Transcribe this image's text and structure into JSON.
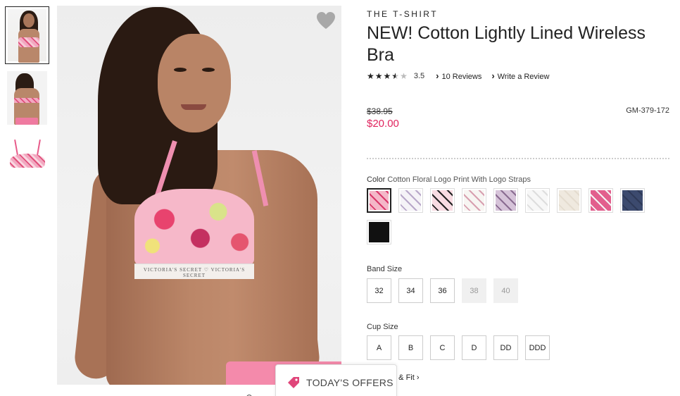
{
  "product": {
    "collection": "THE T-SHIRT",
    "title": "NEW! Cotton Lightly Lined Wireless Bra",
    "rating": 3.5,
    "rating_text": "3.5",
    "reviews_link": "10 Reviews",
    "write_review_link": "Write a Review",
    "old_price": "$38.95",
    "price": "$20.00",
    "sku": "GM-379-172"
  },
  "color": {
    "label": "Color",
    "selected": "Cotton Floral Logo Print With Logo Straps",
    "swatches": [
      {
        "name": "floral-logo-print",
        "bg": "#f4b7c8",
        "accent": "#d9376a"
      },
      {
        "name": "white-logo-print",
        "bg": "#f5f3f7",
        "accent": "#b8a7c9"
      },
      {
        "name": "pink-logo-black-band",
        "bg": "#f8dbe2",
        "accent": "#222222"
      },
      {
        "name": "white-script-print",
        "bg": "#f7f5f2",
        "accent": "#d8a0b0"
      },
      {
        "name": "purple-leopard",
        "bg": "#d6c3d9",
        "accent": "#8a6c91"
      },
      {
        "name": "white-solid",
        "bg": "#f7f7f7",
        "accent": "#dddddd"
      },
      {
        "name": "ivory-solid",
        "bg": "#efe9df",
        "accent": "#e4dccf"
      },
      {
        "name": "pink-logo-band",
        "bg": "#e25f8d",
        "accent": "#f4f4f4"
      },
      {
        "name": "navy-solid",
        "bg": "#3c4a6e",
        "accent": "#2f3a58"
      },
      {
        "name": "black-solid",
        "bg": "#111111",
        "accent": "#111111"
      }
    ]
  },
  "band_size": {
    "label": "Band Size",
    "options": [
      {
        "label": "32",
        "available": true
      },
      {
        "label": "34",
        "available": true
      },
      {
        "label": "36",
        "available": true
      },
      {
        "label": "38",
        "available": false
      },
      {
        "label": "40",
        "available": false
      }
    ]
  },
  "cup_size": {
    "label": "Cup Size",
    "options": [
      {
        "label": "A",
        "available": true
      },
      {
        "label": "B",
        "available": true
      },
      {
        "label": "C",
        "available": true
      },
      {
        "label": "D",
        "available": true
      },
      {
        "label": "DD",
        "available": true
      },
      {
        "label": "DDD",
        "available": true
      }
    ]
  },
  "fit_link_partial": "e & Fit",
  "offers_tab": "TODAY'S OFFERS",
  "hero_band_text": "VICTORIA'S SECRET  ♡  VICTORIA'S SECRET",
  "colors": {
    "sale_price": "#e0245e",
    "text": "#222222"
  }
}
